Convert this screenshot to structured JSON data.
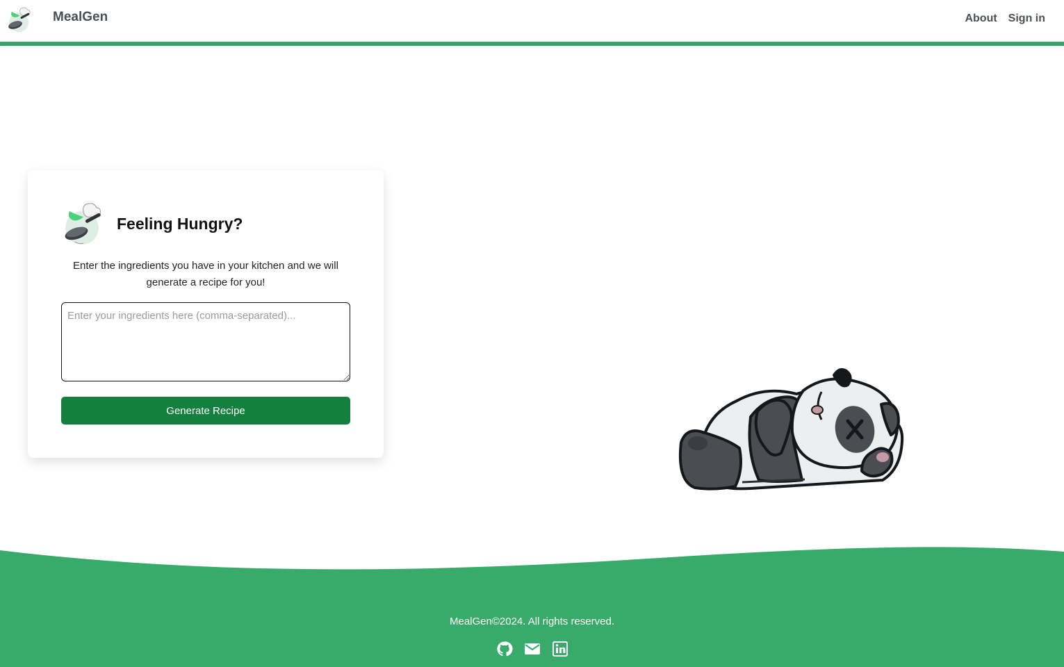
{
  "header": {
    "brand": "MealGen",
    "logo_icon": "pan-icon",
    "nav": [
      {
        "label": "About"
      },
      {
        "label": "Sign in"
      }
    ],
    "accent_color": "#38a169"
  },
  "card": {
    "title": "Feeling Hungry?",
    "description": "Enter the ingredients you have in your kitchen and we will generate a recipe for you!",
    "input": {
      "placeholder": "Enter your ingredients here (comma-separated)...",
      "value": ""
    },
    "button_label": "Generate Recipe",
    "button_color": "#157f3f"
  },
  "illustration": {
    "name": "sleeping-panda"
  },
  "footer": {
    "text": "MealGen©2024. All rights reserved.",
    "background": "#38ab6b",
    "icons": [
      "github-icon",
      "mail-icon",
      "linkedin-icon"
    ]
  }
}
